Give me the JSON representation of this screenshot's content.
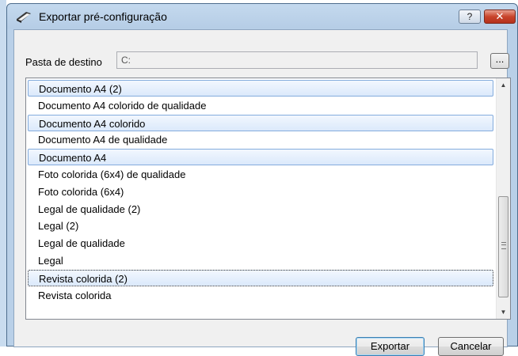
{
  "dialog": {
    "title": "Exportar pré-configuração",
    "help_label": "?",
    "close_label": "✕"
  },
  "destination": {
    "label": "Pasta de destino",
    "value": "C:",
    "browse_label": "..."
  },
  "presets": [
    {
      "label": "Documento A4 (2)",
      "selected": true
    },
    {
      "label": "Documento A4 colorido de qualidade",
      "selected": false
    },
    {
      "label": "Documento A4 colorido",
      "selected": true
    },
    {
      "label": "Documento A4 de qualidade",
      "selected": false
    },
    {
      "label": "Documento A4",
      "selected": true
    },
    {
      "label": "Foto colorida (6x4) de qualidade",
      "selected": false
    },
    {
      "label": "Foto colorida (6x4)",
      "selected": false
    },
    {
      "label": "Legal de qualidade (2)",
      "selected": false
    },
    {
      "label": "Legal (2)",
      "selected": false
    },
    {
      "label": "Legal de qualidade",
      "selected": false
    },
    {
      "label": "Legal",
      "selected": false
    },
    {
      "label": "Revista colorida (2)",
      "selected": true,
      "focused": true
    },
    {
      "label": "Revista colorida",
      "selected": false
    }
  ],
  "buttons": {
    "export": "Exportar",
    "cancel": "Cancelar"
  },
  "colors": {
    "selection_border": "#84acdd",
    "selection_fill": "#dbe9fb",
    "close_button": "#c8442c"
  }
}
